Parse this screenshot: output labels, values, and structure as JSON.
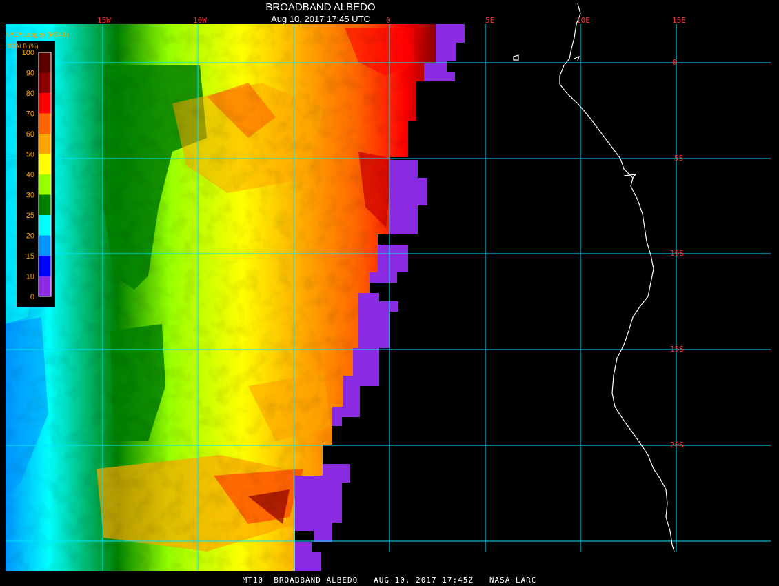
{
  "header": {
    "title": "BROADBAND ALBEDO",
    "subtitle": "Aug 10, 2017 17:45 UTC"
  },
  "credit": "NASA Langley (M04.0)",
  "footer": "MT10  BROADBAND ALBEDO   AUG 10, 2017 17:45Z   NASA LARC",
  "colorbar": {
    "title": "BBALB (%)",
    "ticks": [
      "100",
      "90",
      "80",
      "70",
      "60",
      "50",
      "40",
      "30",
      "25",
      "20",
      "15",
      "10",
      "0"
    ],
    "colors": [
      "#5a0000",
      "#8b0000",
      "#ff0000",
      "#ff6400",
      "#ffa500",
      "#ffff00",
      "#96ff00",
      "#008000",
      "#00ffff",
      "#0096ff",
      "#0000ff",
      "#8a2be2"
    ]
  },
  "grid": {
    "lon_labels": [
      "15W",
      "10W",
      "0",
      "5E",
      "10E",
      "15E"
    ],
    "lat_labels": [
      "0",
      "5S",
      "10S",
      "15S",
      "20S"
    ],
    "line_color": "#00e5ff",
    "label_color": "#ff3030"
  }
}
